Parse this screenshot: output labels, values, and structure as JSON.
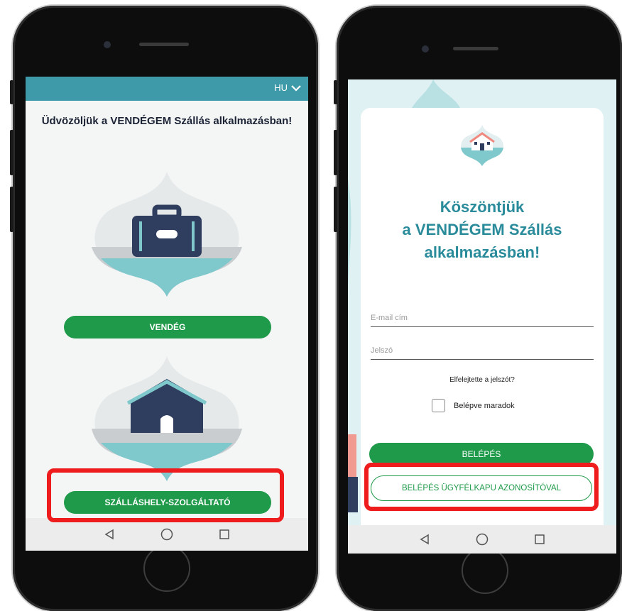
{
  "colors": {
    "teal_bar": "#3e9aa8",
    "green_button": "#1f9a4a",
    "title_teal": "#2a8b9b",
    "highlight_red": "#ee1c1c",
    "suitcase_navy": "#2f3e5e",
    "water_teal": "#7fc8cc"
  },
  "left_screen": {
    "lang_selector": "HU",
    "welcome_text": "Üdvözöljük a VENDÉGEM Szállás alkalmazásban!",
    "guest_button": "VENDÉG",
    "host_button": "SZÁLLÁSHELY-SZOLGÁLTATÓ",
    "icons": [
      "suitcase-icon",
      "house-icon",
      "chevron-down-icon"
    ]
  },
  "right_screen": {
    "title_line1": "Köszöntjük",
    "title_line2": "a VENDÉGEM Szállás",
    "title_line3": "alkalmazásban!",
    "email_placeholder": "E-mail cím",
    "password_placeholder": "Jelszó",
    "forgot_password": "Elfelejtette a jelszót?",
    "remember_me": "Belépve maradok",
    "login_button": "BELÉPÉS",
    "ugyfelkapu_button": "BELÉPÉS ÜGYFÉLKAPU AZONOSÍTÓVAL"
  },
  "navbar": {
    "icons": [
      "back-icon",
      "home-icon",
      "recents-icon"
    ]
  }
}
